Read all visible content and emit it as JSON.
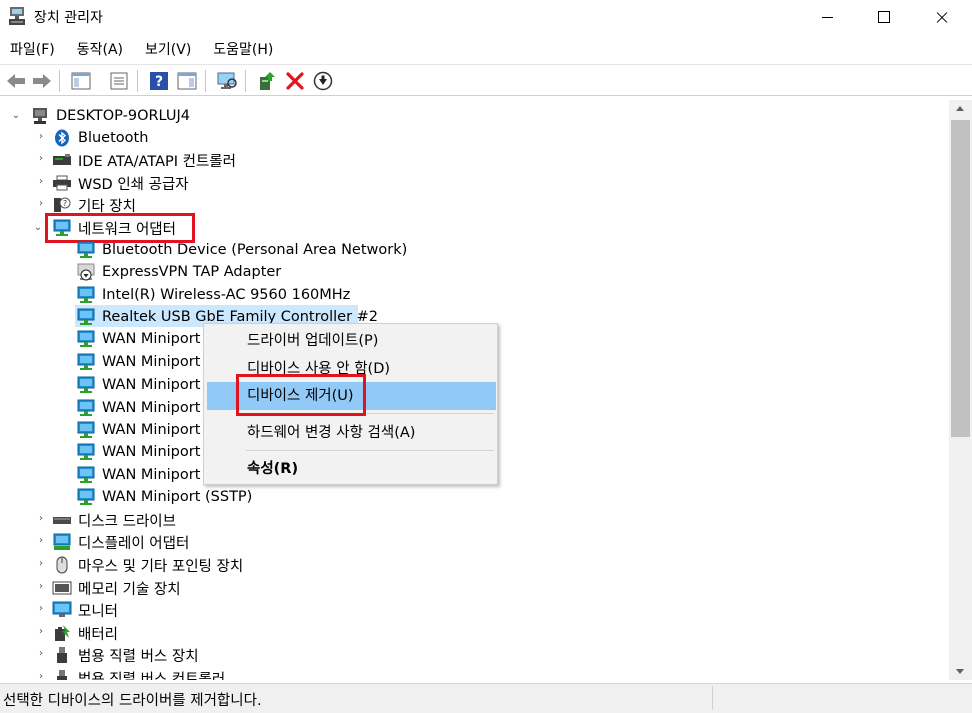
{
  "window": {
    "title": "장치 관리자",
    "menu": [
      "파일(F)",
      "동작(A)",
      "보기(V)",
      "도움말(H)"
    ]
  },
  "tree": {
    "root": "DESKTOP-9ORLUJ4",
    "categories_top": [
      "Bluetooth",
      "IDE ATA/ATAPI 컨트롤러",
      "WSD 인쇄 공급자",
      "기타 장치"
    ],
    "expanded_category": "네트워크 어댑터",
    "network_adapters": [
      "Bluetooth Device (Personal Area Network)",
      "ExpressVPN TAP Adapter",
      "Intel(R) Wireless-AC 9560 160MHz",
      "Realtek USB GbE Family Controller #2",
      "WAN Miniport",
      "WAN Miniport",
      "WAN Miniport",
      "WAN Miniport",
      "WAN Miniport",
      "WAN Miniport",
      "WAN Miniport",
      "WAN Miniport (SSTP)"
    ],
    "categories_bottom": [
      "디스크 드라이브",
      "디스플레이 어댑터",
      "마우스 및 기타 포인팅 장치",
      "메모리 기술 장치",
      "모니터",
      "배터리",
      "범용 직렬 버스 장치",
      "범용 직렬 버스 컨트롤러"
    ]
  },
  "context_menu": {
    "update_driver": "드라이버 업데이트(P)",
    "disable_device": "디바이스 사용 안 함(D)",
    "uninstall_device": "디바이스 제거(U)",
    "scan_hardware": "하드웨어 변경 사항 검색(A)",
    "properties": "속성(R)"
  },
  "status": {
    "text": "선택한 디바이스의 드라이버를 제거합니다."
  },
  "colors": {
    "selection": "#cce8ff",
    "menu_highlight": "#91c9f7",
    "annotation_red": "#e0141e",
    "net_icon": "#1e8fd6"
  }
}
